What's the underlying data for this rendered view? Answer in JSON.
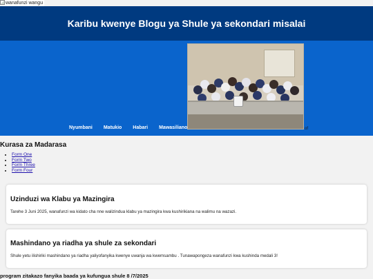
{
  "top_alt_text": "wanafunzi wangu",
  "header": {
    "title": "Karibu kwenye Blogu ya Shule ya sekondari misalai"
  },
  "nav": {
    "links": [
      "Nyumbani",
      "Matukio",
      "Habari",
      "Mawasiliano"
    ],
    "photo_tag": "of"
  },
  "courses": {
    "title": "Kurasa za Madarasa",
    "items": [
      "Form One",
      "Form Two",
      "Form Three",
      "Form Four"
    ]
  },
  "posts": [
    {
      "title": "Uzinduzi wa Klabu ya Mazingira",
      "body": "Tarehe 3 Juni 2025, wanafunzi wa kidato cha nne walizindua klabu ya mazingira kwa kushirikiana na walimu na wazazi."
    },
    {
      "title": "Mashindano ya riadha ya shule za sekondari",
      "body": "Shule yetu ilishiriki mashindano ya riadha yaliyofanyika kwenye uwanja wa kwemsambu . Tunawapongeza wanafunzi kwa kushinda medali 3!"
    }
  ],
  "program_heading": "program zitakazo fanyika baada ya kufungua shule 8 /7/2025",
  "colors": {
    "header_bg": "#003a80",
    "nav_bg": "#0a64cc",
    "page_bg": "#f2f2f2",
    "link": "#1a0dab"
  }
}
